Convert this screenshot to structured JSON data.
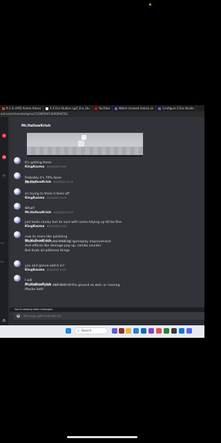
{
  "browser": {
    "tabs": [
      {
        "label": "ft 2 & UPD] Anime Adven",
        "color": "#e23d3d"
      },
      {
        "label": "X Z Era Studios (@Z_Era_Stu",
        "color": "#ffffff"
      },
      {
        "label": "YouTube",
        "color": "#ff0000"
      },
      {
        "label": "Watch Undead Unlock on",
        "color": "#9146ff"
      },
      {
        "label": "Configure Z Era Studio",
        "color": "#5865f2"
      }
    ],
    "url": "ord.com/channels/@me/1158659473400094762"
  },
  "rail": {
    "badges": [
      {
        "label": "2",
        "color": "#f23f42"
      },
      {
        "label": "38",
        "color": "#f23f42"
      },
      {
        "label": "+",
        "color": "#23a559"
      }
    ],
    "side_labels": [
      "rng...",
      "ing..."
    ]
  },
  "chat": {
    "top_user": "Mr.HallowKrish",
    "messages": [
      {
        "user": "KingKazma",
        "time": "10/10/2023 14:03",
        "lines": [
          "It's getting there"
        ]
      },
      {
        "user": "Mr.HallowKrish",
        "time": "10/10/2023 14:18",
        "lines": [
          "Probably it's 70% done",
          "Isn't it?"
        ]
      },
      {
        "user": "KingKazma",
        "time": "10/10/2023 14:19",
        "lines": [
          "im trying to think it feels off"
        ]
      },
      {
        "user": "Mr.HallowKrish",
        "time": "10/10/2023 14:19",
        "lines": [
          "What?"
        ]
      },
      {
        "user": "KingKazma",
        "time": "10/10/2023 14:20",
        "lines": [
          "just looks clunky but im sure with some tidying up itll be fine"
        ]
      },
      {
        "user": "Mr.HallowKrish",
        "time": "10/10/2023 14:20",
        "lines": [
          "now its more like polishing",
          "Sounds, vfx, camera shaking, gameplay improvement",
          "And effects like damage pop up, combo counter",
          "But thats all aditional things"
        ]
      },
      {
        "user": "KingKazma",
        "time": "10/10/2023 14:27",
        "lines": [
          "you aint gonna add it in?"
        ]
      },
      {
        "user": "Mr.HallowKrish",
        "time": "10/10/2023 14:27",
        "lines": [
          "I will",
          "It would be good add dash in the ground as well, or running",
          "Maybe both"
        ]
      }
    ],
    "older_notice": "You're viewing older messages",
    "composer_placeholder": "Message @Mr.HallowKrish"
  },
  "taskbar": {
    "search_label": "Search",
    "icon_colors": [
      "#1e88e5",
      "#5b5fc7",
      "#8b2f2f",
      "#f2b233",
      "#2a7de1",
      "#0f6cbd",
      "#7a4cc2",
      "#e14f5a",
      "#2e7d32",
      "#3b3b3b",
      "#0a7bd1",
      "#5865f2"
    ]
  },
  "colors": {
    "accent": "#5865f2",
    "background": "#313338",
    "sidebar": "#1e1f22"
  }
}
